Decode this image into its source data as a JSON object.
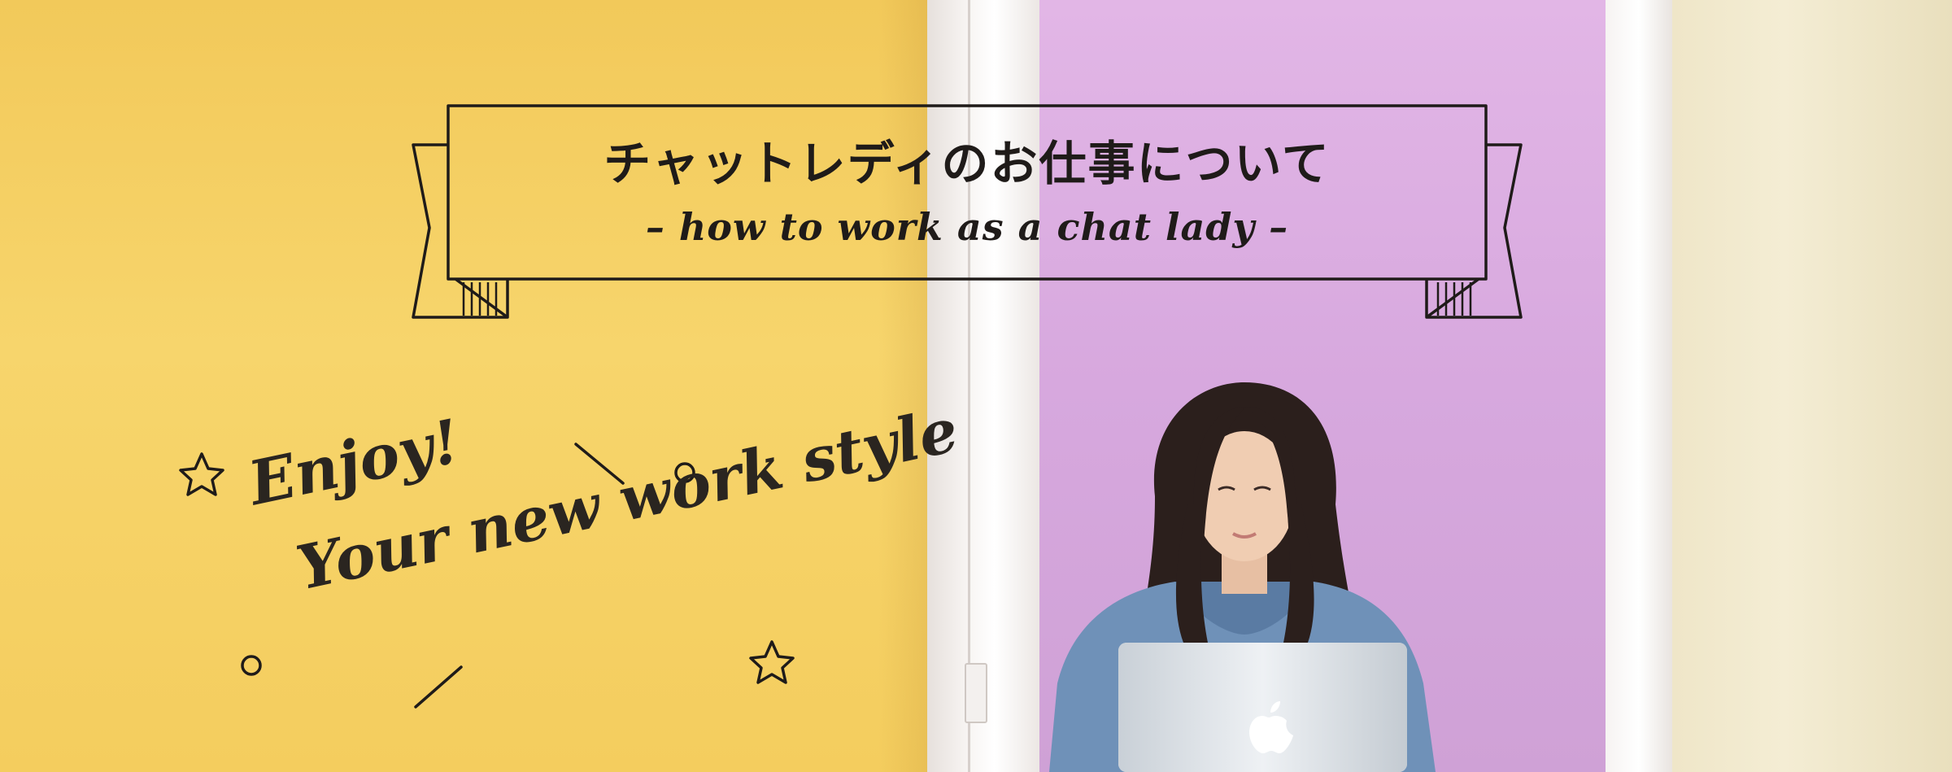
{
  "banner": {
    "title": "チャットレディのお仕事について",
    "subtitle": "– how to work as a chat lady –"
  },
  "slogan": {
    "line1": "Enjoy!",
    "line2": "Your new work style"
  },
  "colors": {
    "yellow_panel": "#f4cd5e",
    "purple_panel": "#d7a8de",
    "ink": "#1f1b19"
  },
  "icons": [
    "star-icon",
    "circle-icon",
    "dash-icon",
    "apple-logo-icon"
  ]
}
